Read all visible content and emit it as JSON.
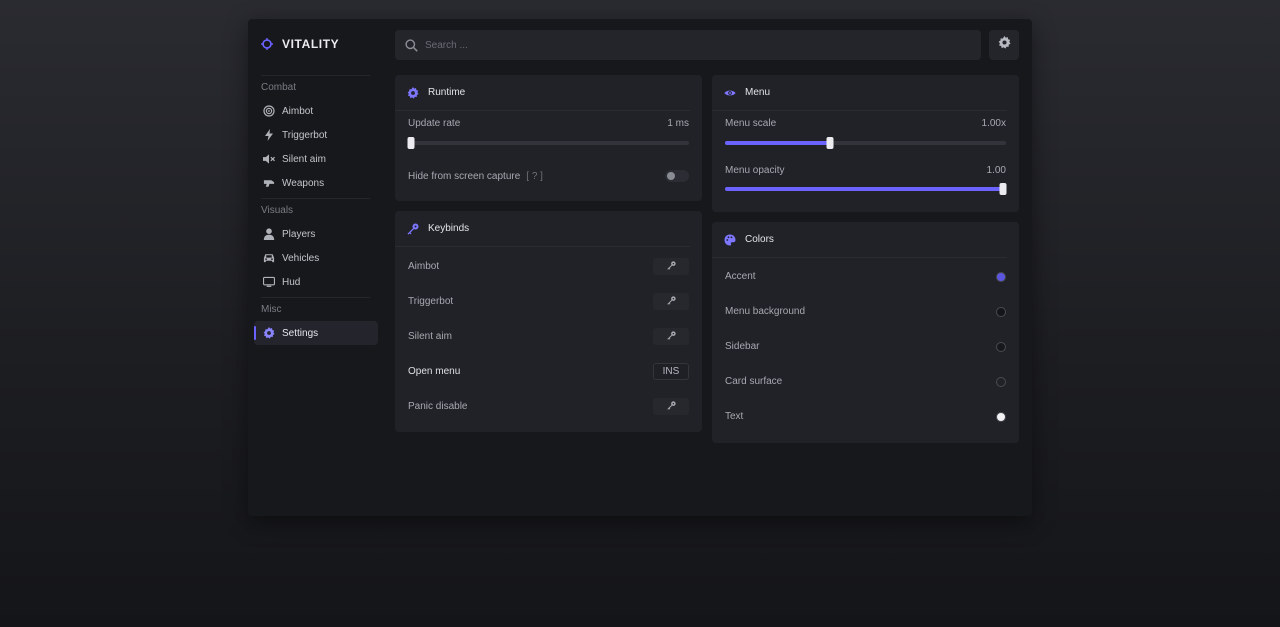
{
  "brand": {
    "name": "VITALITY"
  },
  "search": {
    "placeholder": "Search ..."
  },
  "sidebar": {
    "sections": [
      {
        "label": "Combat",
        "items": [
          {
            "label": "Aimbot",
            "icon": "target-icon"
          },
          {
            "label": "Triggerbot",
            "icon": "bolt-icon"
          },
          {
            "label": "Silent aim",
            "icon": "mute-icon"
          },
          {
            "label": "Weapons",
            "icon": "weapon-icon"
          }
        ]
      },
      {
        "label": "Visuals",
        "items": [
          {
            "label": "Players",
            "icon": "user-icon"
          },
          {
            "label": "Vehicles",
            "icon": "car-icon"
          },
          {
            "label": "Hud",
            "icon": "monitor-icon"
          }
        ]
      },
      {
        "label": "Misc",
        "items": [
          {
            "label": "Settings",
            "icon": "gear-icon",
            "active": true
          }
        ]
      }
    ]
  },
  "runtime": {
    "title": "Runtime",
    "update_rate": {
      "label": "Update rate",
      "value": "1 ms",
      "fraction": 0.0
    },
    "hide_capture": {
      "label": "Hide from screen capture",
      "hint": "[ ? ]",
      "enabled": false
    }
  },
  "menu": {
    "title": "Menu",
    "scale": {
      "label": "Menu scale",
      "value": "1.00x",
      "fraction": 0.375
    },
    "opacity": {
      "label": "Menu opacity",
      "value": "1.00",
      "fraction": 1.0
    }
  },
  "keybinds": {
    "title": "Keybinds",
    "items": [
      {
        "label": "Aimbot",
        "key": ""
      },
      {
        "label": "Triggerbot",
        "key": ""
      },
      {
        "label": "Silent aim",
        "key": ""
      },
      {
        "label": "Open menu",
        "key": "INS"
      },
      {
        "label": "Panic disable",
        "key": ""
      }
    ]
  },
  "colors": {
    "title": "Colors",
    "items": [
      {
        "label": "Accent",
        "color": "#5b55e0"
      },
      {
        "label": "Menu background",
        "color": "#141518"
      },
      {
        "label": "Sidebar",
        "color": "#17181c"
      },
      {
        "label": "Card surface",
        "color": "#212228"
      },
      {
        "label": "Text",
        "color": "#f2f2f5"
      }
    ]
  },
  "theme": {
    "accent": "#6c63ff"
  }
}
